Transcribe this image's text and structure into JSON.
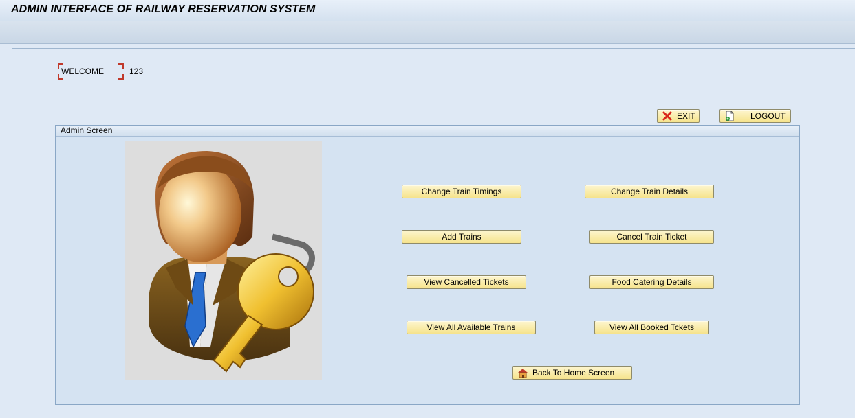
{
  "app": {
    "title": "ADMIN INTERFACE OF RAILWAY RESERVATION SYSTEM"
  },
  "welcome": {
    "label": "WELCOME",
    "value": "123"
  },
  "actions": {
    "exit": {
      "label": "EXIT",
      "icon": "red-x-icon"
    },
    "logout": {
      "label": "LOGOUT",
      "icon": "logout-document-icon"
    }
  },
  "admin_screen": {
    "title": "Admin Screen",
    "image": "admin-user-with-key-illustration",
    "buttons": {
      "change_train_timings": "Change Train Timings",
      "change_train_details": "Change Train Details",
      "add_trains": "Add Trains",
      "cancel_train_ticket": "Cancel Train Ticket",
      "view_cancelled_tickets": "View Cancelled Tickets",
      "food_catering_details": "Food Catering Details",
      "view_all_available_trains": "View All Available Trains",
      "view_all_booked_tickets": "View All Booked Tckets",
      "back_to_home": "Back To Home Screen"
    }
  },
  "colors": {
    "button_fill": "#f6e38c",
    "background": "#dfe9f5",
    "group_background": "#d5e3f2"
  }
}
